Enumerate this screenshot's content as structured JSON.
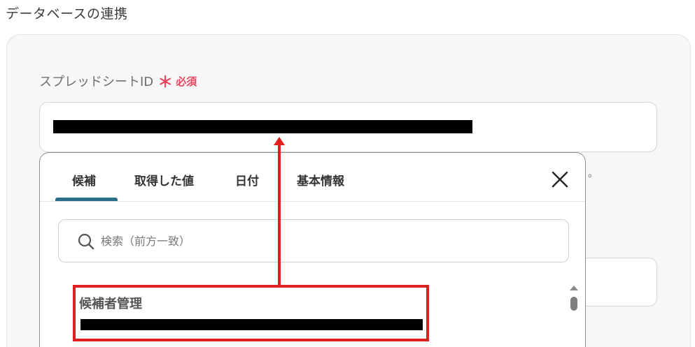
{
  "section": {
    "title": "データベースの連携"
  },
  "field": {
    "label": "スプレッドシートID",
    "required_mark": "＊",
    "required_text": "必須"
  },
  "hint": {
    "trailing_char": "。"
  },
  "popup": {
    "tabs": [
      {
        "label": "候補",
        "active": true
      },
      {
        "label": "取得した値",
        "active": false
      },
      {
        "label": "日付",
        "active": false
      },
      {
        "label": "基本情報",
        "active": false
      }
    ],
    "search": {
      "placeholder": "検索（前方一致）",
      "value": ""
    },
    "items": [
      {
        "title": "候補者管理"
      }
    ]
  },
  "colors": {
    "accent": "#2a6e88",
    "required": "#e8475f",
    "annotation": "#e02020"
  },
  "icons": {
    "close": "close-icon",
    "search": "search-icon"
  }
}
